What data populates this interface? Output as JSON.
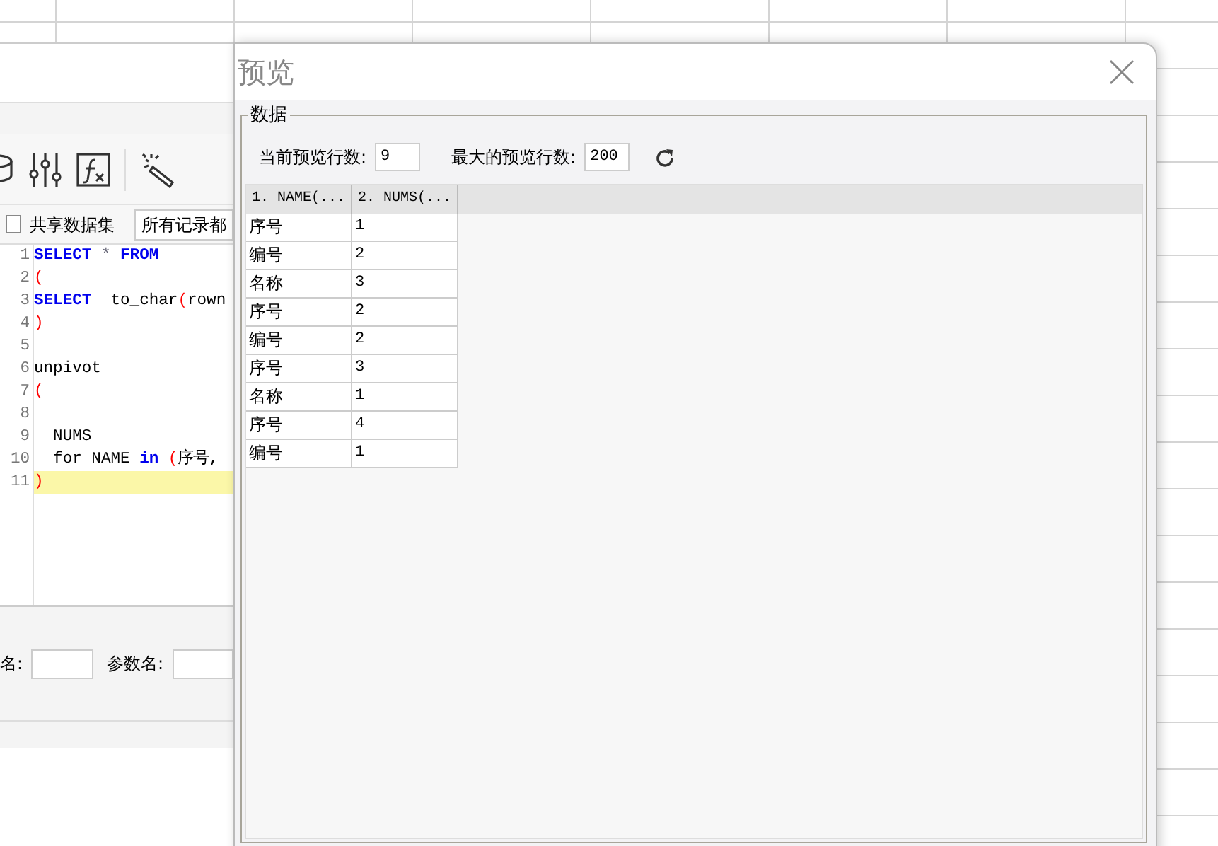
{
  "editor": {
    "share_dataset": {
      "label": "共享数据集",
      "checked": false
    },
    "record_select": {
      "value": "所有记录都"
    },
    "code_lines": [
      {
        "num": "1",
        "tokens": [
          {
            "kind": "keyword",
            "text": "SELECT"
          },
          {
            "kind": "op",
            "text": " * "
          },
          {
            "kind": "keyword",
            "text": "FROM"
          }
        ]
      },
      {
        "num": "2",
        "tokens": [
          {
            "kind": "paren",
            "text": "("
          }
        ]
      },
      {
        "num": "3",
        "tokens": [
          {
            "kind": "keyword",
            "text": "SELECT"
          },
          {
            "kind": "plain",
            "text": "  to_char"
          },
          {
            "kind": "paren",
            "text": "("
          },
          {
            "kind": "plain",
            "text": "rown"
          }
        ]
      },
      {
        "num": "4",
        "tokens": [
          {
            "kind": "paren",
            "text": ")"
          }
        ]
      },
      {
        "num": "5"
      },
      {
        "num": "6",
        "tokens": [
          {
            "kind": "plain",
            "text": "unpivot"
          }
        ]
      },
      {
        "num": "7",
        "tokens": [
          {
            "kind": "paren",
            "text": "("
          }
        ]
      },
      {
        "num": "8"
      },
      {
        "num": "9",
        "tokens": [
          {
            "kind": "plain",
            "text": "  NUMS"
          }
        ]
      },
      {
        "num": "10",
        "tokens": [
          {
            "kind": "plain",
            "text": "  for NAME "
          },
          {
            "kind": "keyword",
            "text": "in"
          },
          {
            "kind": "paren",
            "text": " ("
          },
          {
            "kind": "plain",
            "text": "序号,"
          }
        ]
      },
      {
        "num": "11",
        "current": true,
        "tokens": [
          {
            "kind": "paren",
            "text": ")"
          }
        ]
      }
    ],
    "fields": [
      {
        "label": "名:"
      },
      {
        "label": "参数名:"
      }
    ]
  },
  "dialog": {
    "title": "预览",
    "group": "数据",
    "current_rows": {
      "label": "当前预览行数:",
      "value": "9"
    },
    "max_rows": {
      "label": "最大的预览行数:",
      "value": "200"
    },
    "table": {
      "columns": [
        "1. NAME(...",
        "2. NUMS(..."
      ],
      "rows": [
        [
          "序号",
          "1"
        ],
        [
          "编号",
          "2"
        ],
        [
          "名称",
          "3"
        ],
        [
          "序号",
          "2"
        ],
        [
          "编号",
          "2"
        ],
        [
          "序号",
          "3"
        ],
        [
          "名称",
          "1"
        ],
        [
          "序号",
          "4"
        ],
        [
          "编号",
          "1"
        ]
      ]
    }
  }
}
